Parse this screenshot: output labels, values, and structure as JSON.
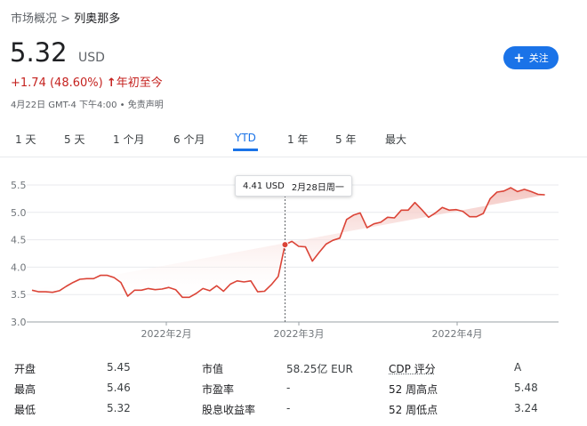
{
  "breadcrumb": {
    "parent": "市场概况",
    "sep": ">",
    "current": "列奥那多"
  },
  "quote": {
    "price": "5.32",
    "currency": "USD",
    "change": "+1.74 (48.60%)",
    "change_arrow": "↑",
    "period": "年初至今"
  },
  "meta": {
    "timestamp": "4月22日 GMT-4 下午4:00",
    "dot": "•",
    "disclaimer": "免责声明"
  },
  "follow": {
    "icon": "plus-icon",
    "label": "关注"
  },
  "ranges": [
    "1 天",
    "5 天",
    "1 个月",
    "6 个月",
    "YTD",
    "1 年",
    "5 年",
    "最大"
  ],
  "active_range": "YTD",
  "colors": {
    "line": "#db4437",
    "fill_top": "#f3c2bd",
    "accent": "#1a73e8",
    "negative": "#c5221f"
  },
  "tooltip": {
    "price": "4.41 USD",
    "date": "2月28日周一"
  },
  "chart_data": {
    "type": "area",
    "xlabels": [
      "2022年2月",
      "2022年3月",
      "2022年4月"
    ],
    "ylabels": [
      "5.5",
      "5.0",
      "4.5",
      "4.0",
      "3.5",
      "3.0"
    ],
    "ylim": [
      3.0,
      5.5
    ],
    "grid": true,
    "x": [
      0,
      1,
      2,
      3,
      4,
      5,
      6,
      7,
      8,
      9,
      10,
      11,
      12,
      13,
      14,
      15,
      16,
      17,
      18,
      19,
      20,
      21,
      22,
      23,
      24,
      25,
      26,
      27,
      28,
      29,
      30,
      31,
      32,
      33,
      34,
      35,
      36,
      37,
      38,
      39,
      40,
      41,
      42,
      43,
      44,
      45,
      46,
      47,
      48,
      49,
      50,
      51,
      52,
      53,
      54,
      55,
      56,
      57,
      58,
      59,
      60,
      61,
      62,
      63,
      64,
      65,
      66,
      67,
      68,
      69,
      70,
      71,
      72,
      73,
      74,
      75,
      76,
      77
    ],
    "y": [
      3.58,
      3.55,
      3.55,
      3.54,
      3.57,
      3.65,
      3.72,
      3.78,
      3.79,
      3.79,
      3.85,
      3.85,
      3.81,
      3.72,
      3.47,
      3.58,
      3.58,
      3.61,
      3.59,
      3.6,
      3.63,
      3.59,
      3.45,
      3.45,
      3.52,
      3.61,
      3.57,
      3.66,
      3.56,
      3.69,
      3.75,
      3.73,
      3.75,
      3.55,
      3.56,
      3.68,
      3.83,
      4.41,
      4.47,
      4.38,
      4.37,
      4.11,
      4.27,
      4.42,
      4.49,
      4.53,
      4.87,
      4.95,
      4.99,
      4.72,
      4.79,
      4.82,
      4.91,
      4.9,
      5.04,
      5.04,
      5.18,
      5.05,
      4.91,
      4.99,
      5.09,
      5.04,
      5.05,
      5.02,
      4.92,
      4.92,
      4.98,
      5.25,
      5.37,
      5.39,
      5.45,
      5.38,
      5.42,
      5.38,
      5.33,
      5.32
    ],
    "highlight": {
      "index": 37,
      "price": "4.41 USD",
      "date": "2月28日周一"
    }
  },
  "stats": {
    "col1": [
      {
        "label": "开盘",
        "value": "5.45"
      },
      {
        "label": "最高",
        "value": "5.46"
      },
      {
        "label": "最低",
        "value": "5.32"
      }
    ],
    "col2": [
      {
        "label": "市值",
        "value": "58.25亿 EUR"
      },
      {
        "label": "市盈率",
        "value": "-"
      },
      {
        "label": "股息收益率",
        "value": "-"
      }
    ],
    "col3": [
      {
        "label": "CDP 评分",
        "value": "A"
      },
      {
        "label": "52 周高点",
        "value": "5.48"
      },
      {
        "label": "52 周低点",
        "value": "3.24"
      }
    ]
  }
}
